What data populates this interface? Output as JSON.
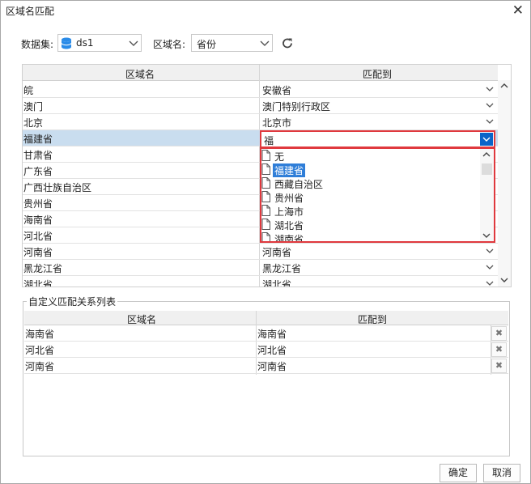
{
  "window": {
    "title": "区域名匹配",
    "close_glyph": "✕"
  },
  "toolbar": {
    "dataset_label": "数据集:",
    "dataset_value": "ds1",
    "region_label": "区域名:",
    "region_value": "省份"
  },
  "grid": {
    "col_name": "区域名",
    "col_match": "匹配到",
    "rows": [
      {
        "name": "皖",
        "match": "安徽省"
      },
      {
        "name": "澳门",
        "match": "澳门特别行政区"
      },
      {
        "name": "北京",
        "match": "北京市"
      },
      {
        "name": "福建省",
        "match": "福"
      },
      {
        "name": "甘肃省",
        "match": ""
      },
      {
        "name": "广东省",
        "match": ""
      },
      {
        "name": "广西壮族自治区",
        "match": ""
      },
      {
        "name": "贵州省",
        "match": ""
      },
      {
        "name": "海南省",
        "match": ""
      },
      {
        "name": "河北省",
        "match": ""
      },
      {
        "name": "河南省",
        "match": "河南省"
      },
      {
        "name": "黑龙江省",
        "match": "黑龙江省"
      },
      {
        "name": "湖北省",
        "match": "湖北省"
      }
    ]
  },
  "dropdown": {
    "options": [
      "无",
      "福建省",
      "西藏自治区",
      "贵州省",
      "上海市",
      "湖北省",
      "湖南省"
    ],
    "highlighted": "福建省"
  },
  "custom": {
    "legend": "自定义匹配关系列表",
    "col_name": "区域名",
    "col_match": "匹配到",
    "rows": [
      {
        "name": "海南省",
        "match": "海南省"
      },
      {
        "name": "河北省",
        "match": "河北省"
      },
      {
        "name": "河南省",
        "match": "河南省"
      }
    ],
    "delete_glyph": "✖"
  },
  "buttons": {
    "ok": "确定",
    "cancel": "取消"
  },
  "colors": {
    "selection": "#c9ddef",
    "highlight": "#2f7ed8",
    "error_border": "#e0393e",
    "dropdown_button": "#0a64c8"
  }
}
